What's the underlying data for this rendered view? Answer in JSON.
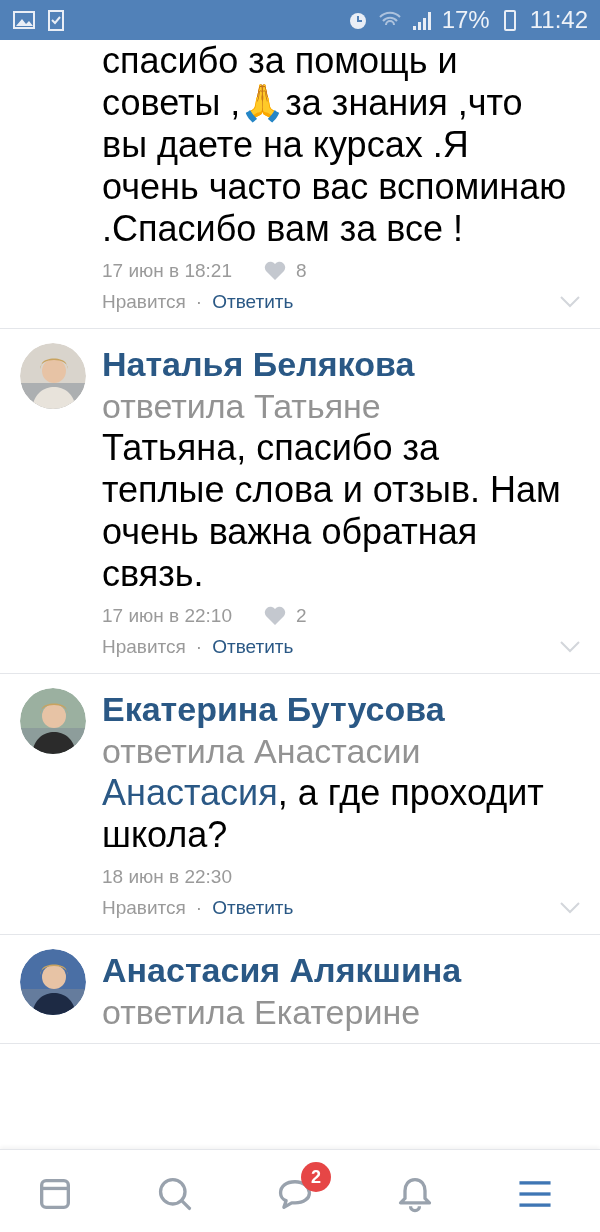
{
  "status_bar": {
    "battery": "17%",
    "time": "11:42"
  },
  "comments": [
    {
      "text": "спасибо за помощь и советы ,🙏за знания ,что вы даете на курсах .Я очень часто вас вспоминаю .Спасибо вам за все !",
      "date": "17 июн в 18:21",
      "likes": "8",
      "like_label": "Нравится",
      "separator": "·",
      "reply_label": "Ответить"
    },
    {
      "author": "Наталья Белякова",
      "reply_to": "ответила Татьяне",
      "text": "Татьяна, спасибо за теплые слова и отзыв. Нам очень важна обратная связь.",
      "date": "17 июн в 22:10",
      "likes": "2",
      "like_label": "Нравится",
      "separator": "·",
      "reply_label": "Ответить"
    },
    {
      "author": "Екатерина Бутусова",
      "reply_to": "ответила Анастасии",
      "mention": "Анастасия",
      "text": ", а где проходит школа?",
      "date": "18 июн в 22:30",
      "like_label": "Нравится",
      "separator": "·",
      "reply_label": "Ответить"
    },
    {
      "author": "Анастасия Алякшина",
      "reply_to": "ответила Екатерине"
    }
  ],
  "nav": [
    {
      "kind": "news",
      "selected": false
    },
    {
      "kind": "search",
      "selected": false
    },
    {
      "kind": "messages",
      "selected": false,
      "badge": "2"
    },
    {
      "kind": "notifications",
      "selected": false
    },
    {
      "kind": "menu",
      "selected": true
    }
  ]
}
